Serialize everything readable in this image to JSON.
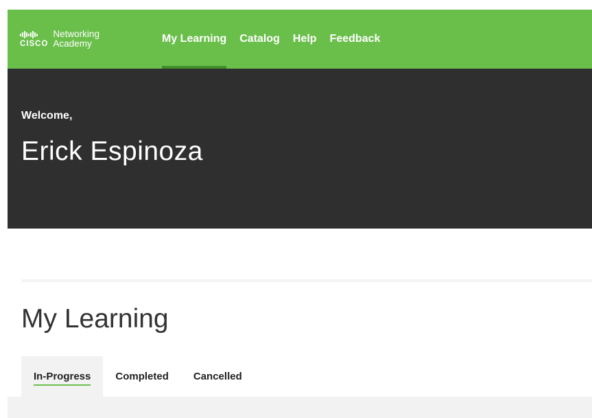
{
  "brand": {
    "logo_word": "CISCO",
    "line1": "Networking",
    "line2": "Academy"
  },
  "nav": {
    "items": [
      {
        "label": "My Learning",
        "active": true
      },
      {
        "label": "Catalog",
        "active": false
      },
      {
        "label": "Help",
        "active": false
      },
      {
        "label": "Feedback",
        "active": false
      }
    ]
  },
  "hero": {
    "welcome": "Welcome,",
    "user_name": "Erick Espinoza"
  },
  "section": {
    "title": "My Learning"
  },
  "tabs": [
    {
      "label": "In-Progress",
      "active": true
    },
    {
      "label": "Completed",
      "active": false
    },
    {
      "label": "Cancelled",
      "active": false
    }
  ],
  "colors": {
    "nav_green": "#6abf4b",
    "nav_active_underline": "#3f8f2b",
    "hero_background": "#2f2f2f",
    "tab_background": "#f2f2f2"
  }
}
